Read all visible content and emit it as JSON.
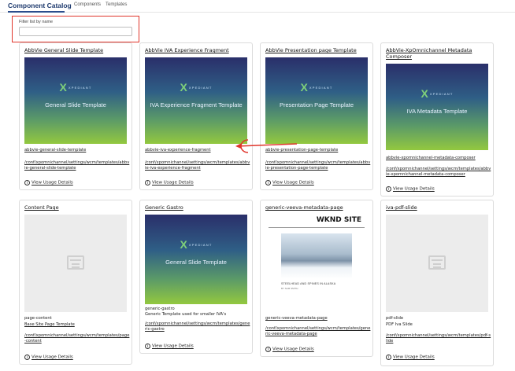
{
  "header": {
    "title": "Component Catalog",
    "nav": [
      "Components",
      "Templates"
    ]
  },
  "filter": {
    "label": "Filter list by name",
    "value": "",
    "placeholder": ""
  },
  "cards": [
    {
      "title": "AbbVie General Slide Template",
      "thumb_brand": "XPEDIANT",
      "thumb_caption": "General Slide Template",
      "name": "abbvie-general-slide-template",
      "description": "",
      "path": "/conf/xpomnichannel/settings/wcm/templates/abbvie-general-slide-template",
      "usage_label": "View Usage Details"
    },
    {
      "title": "AbbVie IVA Experience Fragment",
      "thumb_brand": "XPEDIANT",
      "thumb_caption": "IVA Experience Fragment Template",
      "name": "abbvie-iva-experience-fragment",
      "description": "",
      "path": "/conf/xpomnichannel/settings/wcm/templates/abbvie-iva-experience-fragment",
      "usage_label": "View Usage Details"
    },
    {
      "title": "AbbVie Presentation page Template",
      "thumb_brand": "XPEDIANT",
      "thumb_caption": "Presentation Page Template",
      "name": "abbvie-presentation-page-template",
      "description": "",
      "path": "/conf/xpomnichannel/settings/wcm/templates/abbvie-presentation-page-template",
      "usage_label": "View Usage Details"
    },
    {
      "title": "AbbVie-XpOmnichannel Metadata Composer",
      "thumb_brand": "XPEDIANT",
      "thumb_caption": "IVA Metadata Template",
      "name": "abbvie-xpomnichannel-metadata-composer",
      "description": "",
      "path": "/conf/xpomnichannel/settings/wcm/templates/abbvie-xpomnichannel-metadata-composer",
      "usage_label": "View Usage Details"
    },
    {
      "title": "Content Page",
      "name": "page-content",
      "description": "Base Site Page Template",
      "path": "/conf/xpomnichannel/settings/wcm/templates/page-content",
      "usage_label": "View Usage Details"
    },
    {
      "title": "Generic Gastro",
      "thumb_brand": "XPEDIANT",
      "thumb_caption": "General Slide Template",
      "name": "generic-gastro",
      "description": "Generic Template used for smaller IVA's",
      "path": "/conf/xpomnichannel/settings/wcm/templates/generic-gastro",
      "usage_label": "View Usage Details"
    },
    {
      "title": "generic-veeva-metadata-page",
      "thumb_title": "WKND SITE",
      "thumb_caption": "STEELHEAD AND SPINES IN ALASKA",
      "thumb_byline": "BY SAM SMITH",
      "name": "generic-veeva-metadata-page",
      "description": "",
      "path": "/conf/xpomnichannel/settings/wcm/templates/generic-veeva-metadata-page",
      "usage_label": "View Usage Details"
    },
    {
      "title": "iva-pdf-slide",
      "name": "pdf-slide",
      "description": "PDF Iva Slide",
      "path": "/conf/xpomnichannel/settings/wcm/templates/pdf-slide",
      "usage_label": "View Usage Details"
    }
  ],
  "colors": {
    "annotation": "#e0352b",
    "title": "#1f3b6e"
  }
}
